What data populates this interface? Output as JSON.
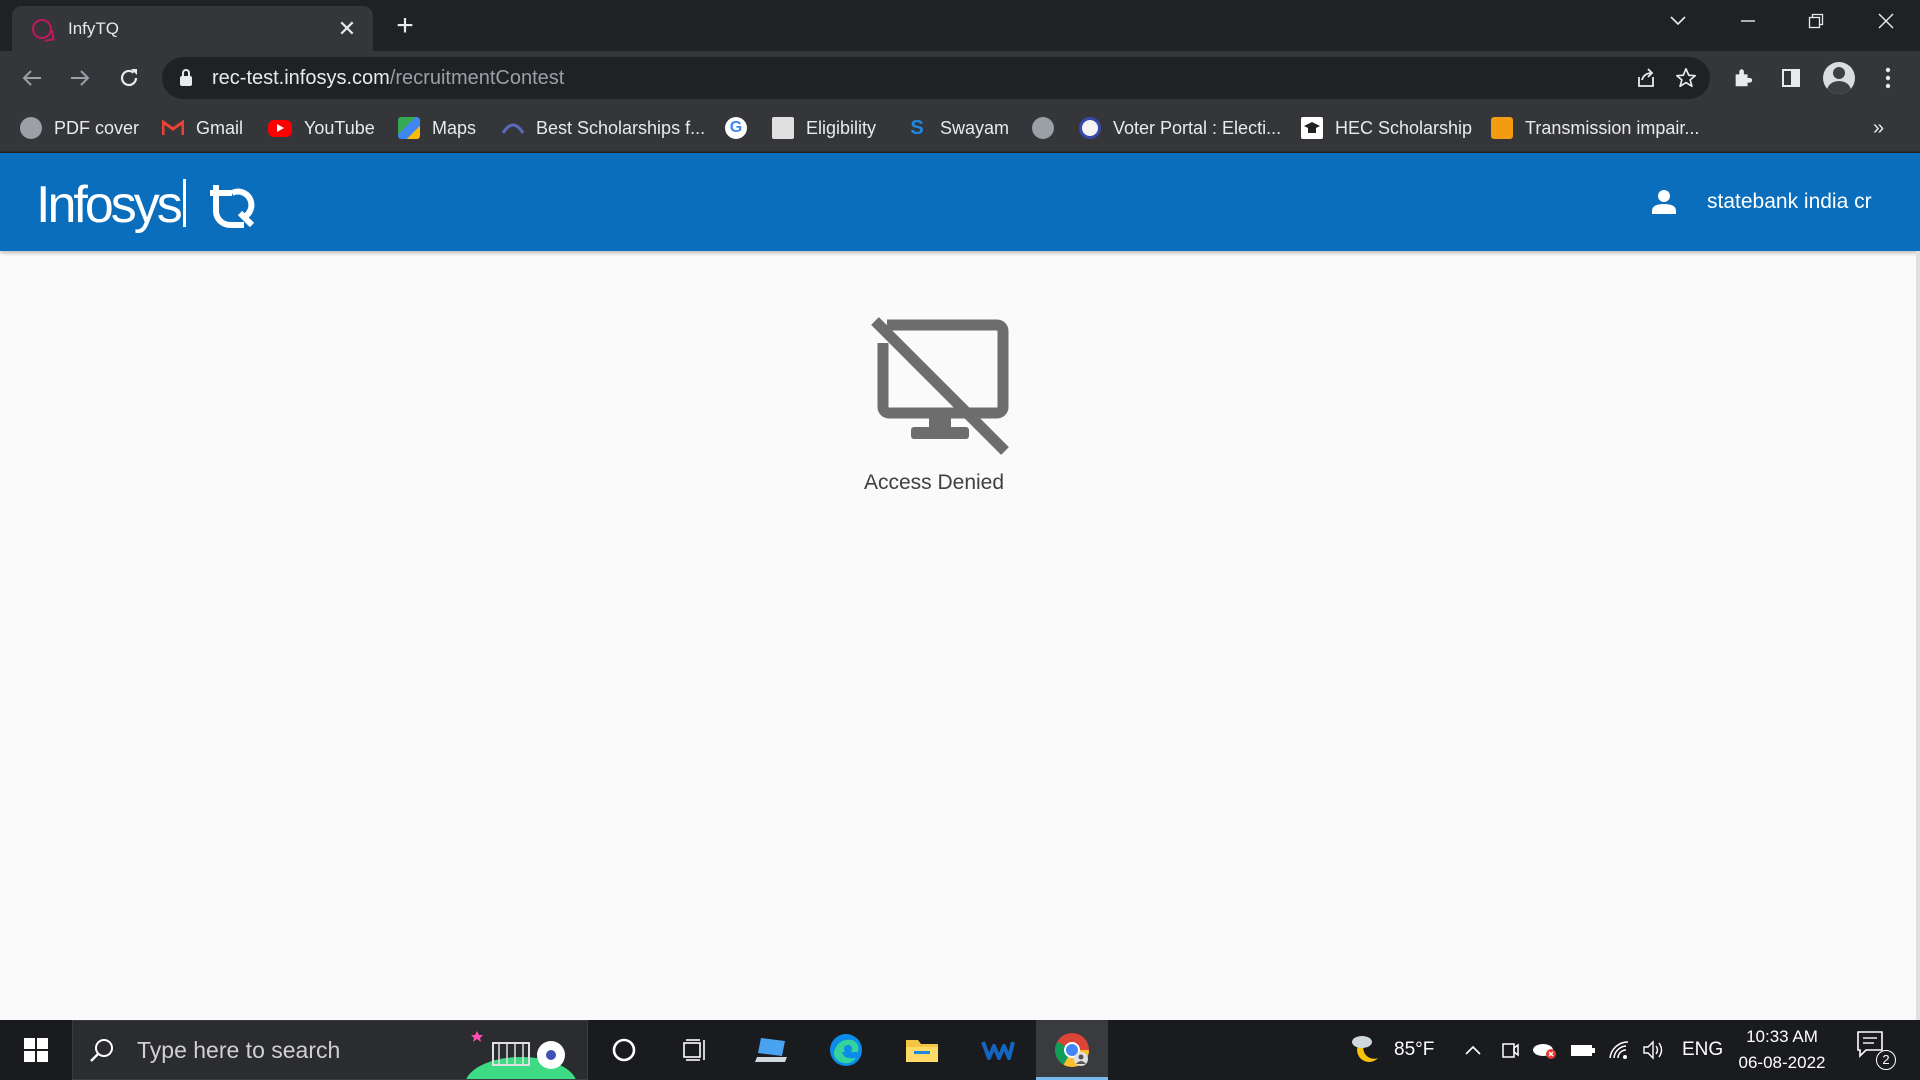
{
  "browser": {
    "tab": {
      "title": "InfyTQ",
      "favicon": "infytq-favicon"
    },
    "address": {
      "host": "rec-test.infosys.com",
      "path": "/recruitmentContest"
    },
    "bookmarks": [
      {
        "label": "PDF cover",
        "icon": "globe-icon"
      },
      {
        "label": "Gmail",
        "icon": "gmail-icon"
      },
      {
        "label": "YouTube",
        "icon": "youtube-icon"
      },
      {
        "label": "Maps",
        "icon": "maps-icon"
      },
      {
        "label": "Best Scholarships f...",
        "icon": "scholarship-icon"
      },
      {
        "label": "",
        "icon": "google-icon"
      },
      {
        "label": "Eligibility",
        "icon": "emblem-icon"
      },
      {
        "label": "Swayam",
        "icon": "swayam-icon"
      },
      {
        "label": "",
        "icon": "globe-icon"
      },
      {
        "label": "Voter Portal : Electi...",
        "icon": "eci-icon"
      },
      {
        "label": "HEC Scholarship",
        "icon": "hec-icon"
      },
      {
        "label": "Transmission impair...",
        "icon": "doc-icon"
      }
    ],
    "bookmarks_overflow": "»"
  },
  "site": {
    "brand": "Infosys",
    "user_name": "statebank india cr",
    "message": "Access Denied",
    "colors": {
      "header": "#0a6ebd",
      "page_bg": "#fafafa",
      "icon": "#6d6d6d"
    }
  },
  "taskbar": {
    "search_placeholder": "Type here to search",
    "weather": "85°F",
    "language": "ENG",
    "time": "10:33 AM",
    "date": "06-08-2022",
    "notification_count": "2"
  }
}
